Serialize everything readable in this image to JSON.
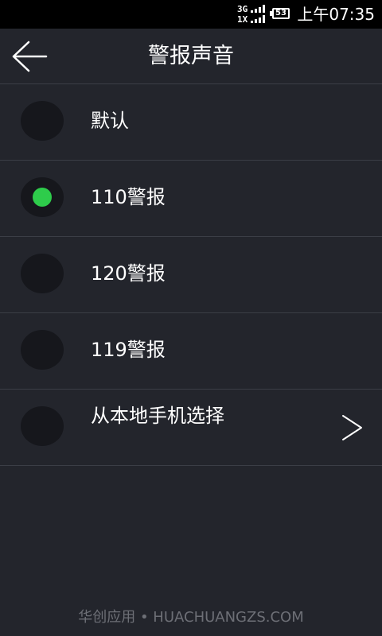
{
  "status_bar": {
    "network_top": "3G",
    "network_bottom": "1X",
    "battery_level": "53",
    "time": "上午07:35"
  },
  "header": {
    "title": "警报声音",
    "back_icon": "arrow-left-icon"
  },
  "options": [
    {
      "label": "默认",
      "selected": false,
      "has_chevron": false
    },
    {
      "label": "110警报",
      "selected": true,
      "has_chevron": false
    },
    {
      "label": "120警报",
      "selected": false,
      "has_chevron": false
    },
    {
      "label": "119警报",
      "selected": false,
      "has_chevron": false
    },
    {
      "label": "从本地手机选择",
      "selected": false,
      "has_chevron": true
    }
  ],
  "watermark": "华创应用 • HUACHUANGZS.COM",
  "colors": {
    "background": "#23252c",
    "status_bar": "#000000",
    "divider": "#3b3e46",
    "radio_fill": "#16171c",
    "selected_dot": "#2ecc4b",
    "watermark_text": "#6d6f76"
  }
}
